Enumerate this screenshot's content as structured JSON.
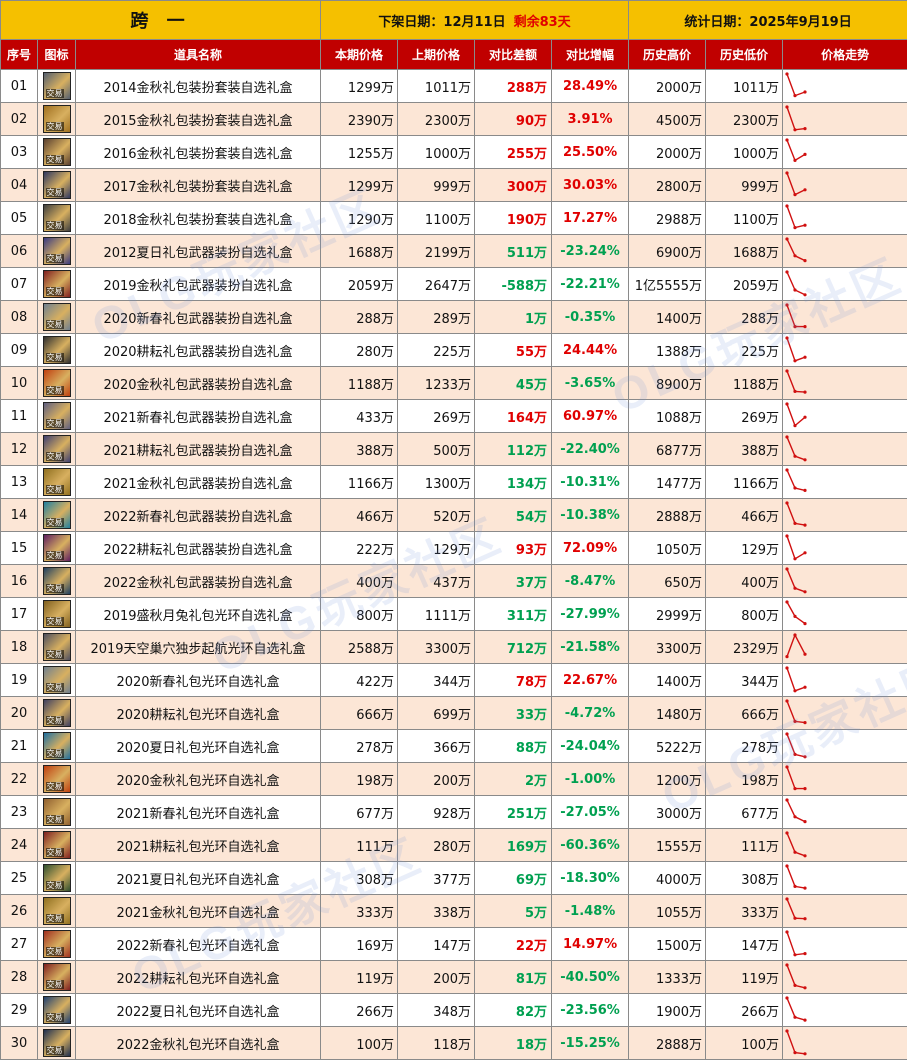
{
  "header": {
    "region": "跨 一",
    "delist_label": "下架日期：",
    "delist_date": "12月11日",
    "remaining": "剩余83天",
    "stat_label": "统计日期：",
    "stat_date": "2025年9月19日"
  },
  "columns": [
    "序号",
    "图标",
    "道具名称",
    "本期价格",
    "上期价格",
    "对比差额",
    "对比增幅",
    "历史高价",
    "历史低价",
    "价格走势"
  ],
  "icon_badge": "交易",
  "watermark": "OLG玩家社区",
  "colors": {
    "top_bar": "#f5c000",
    "header": "#c00000",
    "alt_row": "#fce6d6",
    "up": "#e00000",
    "down": "#00a050",
    "trend_line": "#d01010"
  },
  "rows": [
    {
      "no": "01",
      "name": "2014金秋礼包装扮套装自选礼盒",
      "cur": "1299万",
      "prev": "1011万",
      "diff": "288万",
      "pct": "28.49%",
      "dir": "up",
      "high": "2000万",
      "low": "1011万",
      "icon_color": "#556070",
      "icon_text": "2014",
      "trend": [
        0.0,
        0.9,
        0.75
      ]
    },
    {
      "no": "02",
      "name": "2015金秋礼包装扮套装自选礼盒",
      "cur": "2390万",
      "prev": "2300万",
      "diff": "90万",
      "pct": "3.91%",
      "dir": "up",
      "high": "4500万",
      "low": "2300万",
      "icon_color": "#a07020",
      "icon_text": "2015",
      "trend": [
        0.0,
        0.95,
        0.9
      ]
    },
    {
      "no": "03",
      "name": "2016金秋礼包装扮套装自选礼盒",
      "cur": "1255万",
      "prev": "1000万",
      "diff": "255万",
      "pct": "25.50%",
      "dir": "up",
      "high": "2000万",
      "low": "1000万",
      "icon_color": "#5a4030",
      "icon_text": "2016",
      "trend": [
        0.0,
        0.85,
        0.6
      ]
    },
    {
      "no": "04",
      "name": "2017金秋礼包装扮套装自选礼盒",
      "cur": "1299万",
      "prev": "999万",
      "diff": "300万",
      "pct": "30.03%",
      "dir": "up",
      "high": "2800万",
      "low": "999万",
      "icon_color": "#303860",
      "icon_text": "2017",
      "trend": [
        0.0,
        0.9,
        0.7
      ]
    },
    {
      "no": "05",
      "name": "2018金秋礼包装扮套装自选礼盒",
      "cur": "1290万",
      "prev": "1100万",
      "diff": "190万",
      "pct": "17.27%",
      "dir": "up",
      "high": "2988万",
      "low": "1100万",
      "icon_color": "#404040",
      "icon_text": "2018",
      "trend": [
        0.0,
        0.9,
        0.8
      ]
    },
    {
      "no": "06",
      "name": "2012夏日礼包武器装扮自选礼盒",
      "cur": "1688万",
      "prev": "2199万",
      "diff": "511万",
      "pct": "-23.24%",
      "dir": "down",
      "high": "6900万",
      "low": "1688万",
      "icon_color": "#3a3a80",
      "icon_text": "",
      "trend": [
        0.0,
        0.7,
        0.9
      ]
    },
    {
      "no": "07",
      "name": "2019金秋礼包武器装扮自选礼盒",
      "cur": "2059万",
      "prev": "2647万",
      "diff": "-588万",
      "pct": "-22.21%",
      "dir": "down",
      "high": "1亿5555万",
      "low": "2059万",
      "icon_color": "#802020",
      "icon_text": "",
      "trend": [
        0.0,
        0.75,
        0.95
      ]
    },
    {
      "no": "08",
      "name": "2020新春礼包武器装扮自选礼盒",
      "cur": "288万",
      "prev": "289万",
      "diff": "1万",
      "pct": "-0.35%",
      "dir": "down",
      "high": "1400万",
      "low": "288万",
      "icon_color": "#708090",
      "icon_text": "",
      "trend": [
        0.0,
        0.9,
        0.9
      ]
    },
    {
      "no": "09",
      "name": "2020耕耘礼包武器装扮自选礼盒",
      "cur": "280万",
      "prev": "225万",
      "diff": "55万",
      "pct": "24.44%",
      "dir": "up",
      "high": "1388万",
      "low": "225万",
      "icon_color": "#303030",
      "icon_text": "",
      "trend": [
        0.0,
        0.95,
        0.8
      ]
    },
    {
      "no": "10",
      "name": "2020金秋礼包武器装扮自选礼盒",
      "cur": "1188万",
      "prev": "1233万",
      "diff": "45万",
      "pct": "-3.65%",
      "dir": "down",
      "high": "8900万",
      "low": "1188万",
      "icon_color": "#c04010",
      "icon_text": "",
      "trend": [
        0.0,
        0.85,
        0.88
      ]
    },
    {
      "no": "11",
      "name": "2021新春礼包武器装扮自选礼盒",
      "cur": "433万",
      "prev": "269万",
      "diff": "164万",
      "pct": "60.97%",
      "dir": "up",
      "high": "1088万",
      "low": "269万",
      "icon_color": "#606080",
      "icon_text": "",
      "trend": [
        0.0,
        0.9,
        0.55
      ]
    },
    {
      "no": "12",
      "name": "2021耕耘礼包武器装扮自选礼盒",
      "cur": "388万",
      "prev": "500万",
      "diff": "112万",
      "pct": "-22.40%",
      "dir": "down",
      "high": "6877万",
      "low": "388万",
      "icon_color": "#404070",
      "icon_text": "",
      "trend": [
        0.0,
        0.8,
        0.95
      ]
    },
    {
      "no": "13",
      "name": "2021金秋礼包武器装扮自选礼盒",
      "cur": "1166万",
      "prev": "1300万",
      "diff": "134万",
      "pct": "-10.31%",
      "dir": "down",
      "high": "1477万",
      "low": "1166万",
      "icon_color": "#907020",
      "icon_text": "",
      "trend": [
        0.0,
        0.75,
        0.85
      ]
    },
    {
      "no": "14",
      "name": "2022新春礼包武器装扮自选礼盒",
      "cur": "466万",
      "prev": "520万",
      "diff": "54万",
      "pct": "-10.38%",
      "dir": "down",
      "high": "2888万",
      "low": "466万",
      "icon_color": "#2080a0",
      "icon_text": "",
      "trend": [
        0.0,
        0.85,
        0.92
      ]
    },
    {
      "no": "15",
      "name": "2022耕耘礼包武器装扮自选礼盒",
      "cur": "222万",
      "prev": "129万",
      "diff": "93万",
      "pct": "72.09%",
      "dir": "up",
      "high": "1050万",
      "low": "129万",
      "icon_color": "#602060",
      "icon_text": "",
      "trend": [
        0.0,
        0.95,
        0.7
      ]
    },
    {
      "no": "16",
      "name": "2022金秋礼包武器装扮自选礼盒",
      "cur": "400万",
      "prev": "437万",
      "diff": "37万",
      "pct": "-8.47%",
      "dir": "down",
      "high": "650万",
      "low": "400万",
      "icon_color": "#204060",
      "icon_text": "",
      "trend": [
        0.0,
        0.8,
        0.95
      ]
    },
    {
      "no": "17",
      "name": "2019盛秋月兔礼包光环自选礼盒",
      "cur": "800万",
      "prev": "1111万",
      "diff": "311万",
      "pct": "-27.99%",
      "dir": "down",
      "high": "2999万",
      "low": "800万",
      "icon_color": "#806020",
      "icon_text": "",
      "trend": [
        0.0,
        0.6,
        0.9
      ]
    },
    {
      "no": "18",
      "name": "2019天空巢穴独步起航光环自选礼盒",
      "cur": "2588万",
      "prev": "3300万",
      "diff": "712万",
      "pct": "-21.58%",
      "dir": "down",
      "high": "3300万",
      "low": "2329万",
      "icon_color": "#505060",
      "icon_text": "",
      "trend": [
        0.9,
        0.0,
        0.8
      ]
    },
    {
      "no": "19",
      "name": "2020新春礼包光环自选礼盒",
      "cur": "422万",
      "prev": "344万",
      "diff": "78万",
      "pct": "22.67%",
      "dir": "up",
      "high": "1400万",
      "low": "344万",
      "icon_color": "#708090",
      "icon_text": "",
      "trend": [
        0.0,
        0.95,
        0.8
      ]
    },
    {
      "no": "20",
      "name": "2020耕耘礼包光环自选礼盒",
      "cur": "666万",
      "prev": "699万",
      "diff": "33万",
      "pct": "-4.72%",
      "dir": "down",
      "high": "1480万",
      "low": "666万",
      "icon_color": "#404060",
      "icon_text": "",
      "trend": [
        0.0,
        0.85,
        0.9
      ]
    },
    {
      "no": "21",
      "name": "2020夏日礼包光环自选礼盒",
      "cur": "278万",
      "prev": "366万",
      "diff": "88万",
      "pct": "-24.04%",
      "dir": "down",
      "high": "5222万",
      "low": "278万",
      "icon_color": "#2070a0",
      "icon_text": "",
      "trend": [
        0.0,
        0.85,
        0.95
      ]
    },
    {
      "no": "22",
      "name": "2020金秋礼包光环自选礼盒",
      "cur": "198万",
      "prev": "200万",
      "diff": "2万",
      "pct": "-1.00%",
      "dir": "down",
      "high": "1200万",
      "low": "198万",
      "icon_color": "#c04010",
      "icon_text": "",
      "trend": [
        0.0,
        0.9,
        0.9
      ]
    },
    {
      "no": "23",
      "name": "2021新春礼包光环自选礼盒",
      "cur": "677万",
      "prev": "928万",
      "diff": "251万",
      "pct": "-27.05%",
      "dir": "down",
      "high": "3000万",
      "low": "677万",
      "icon_color": "#906030",
      "icon_text": "",
      "trend": [
        0.0,
        0.7,
        0.9
      ]
    },
    {
      "no": "24",
      "name": "2021耕耘礼包光环自选礼盒",
      "cur": "111万",
      "prev": "280万",
      "diff": "169万",
      "pct": "-60.36%",
      "dir": "down",
      "high": "1555万",
      "low": "111万",
      "icon_color": "#802020",
      "icon_text": "",
      "trend": [
        0.0,
        0.8,
        0.95
      ]
    },
    {
      "no": "25",
      "name": "2021夏日礼包光环自选礼盒",
      "cur": "308万",
      "prev": "377万",
      "diff": "69万",
      "pct": "-18.30%",
      "dir": "down",
      "high": "4000万",
      "low": "308万",
      "icon_color": "#305030",
      "icon_text": "",
      "trend": [
        0.0,
        0.85,
        0.92
      ]
    },
    {
      "no": "26",
      "name": "2021金秋礼包光环自选礼盒",
      "cur": "333万",
      "prev": "338万",
      "diff": "5万",
      "pct": "-1.48%",
      "dir": "down",
      "high": "1055万",
      "low": "333万",
      "icon_color": "#907020",
      "icon_text": "",
      "trend": [
        0.0,
        0.8,
        0.82
      ]
    },
    {
      "no": "27",
      "name": "2022新春礼包光环自选礼盒",
      "cur": "169万",
      "prev": "147万",
      "diff": "22万",
      "pct": "14.97%",
      "dir": "up",
      "high": "1500万",
      "low": "147万",
      "icon_color": "#a03020",
      "icon_text": "",
      "trend": [
        0.0,
        0.95,
        0.9
      ]
    },
    {
      "no": "28",
      "name": "2022耕耘礼包光环自选礼盒",
      "cur": "119万",
      "prev": "200万",
      "diff": "81万",
      "pct": "-40.50%",
      "dir": "down",
      "high": "1333万",
      "low": "119万",
      "icon_color": "#802020",
      "icon_text": "",
      "trend": [
        0.0,
        0.85,
        0.95
      ]
    },
    {
      "no": "29",
      "name": "2022夏日礼包光环自选礼盒",
      "cur": "266万",
      "prev": "348万",
      "diff": "82万",
      "pct": "-23.56%",
      "dir": "down",
      "high": "1900万",
      "low": "266万",
      "icon_color": "#204070",
      "icon_text": "",
      "trend": [
        0.0,
        0.8,
        0.92
      ]
    },
    {
      "no": "30",
      "name": "2022金秋礼包光环自选礼盒",
      "cur": "100万",
      "prev": "118万",
      "diff": "18万",
      "pct": "-15.25%",
      "dir": "down",
      "high": "2888万",
      "low": "100万",
      "icon_color": "#203050",
      "icon_text": "",
      "trend": [
        0.0,
        0.9,
        0.95
      ]
    }
  ]
}
